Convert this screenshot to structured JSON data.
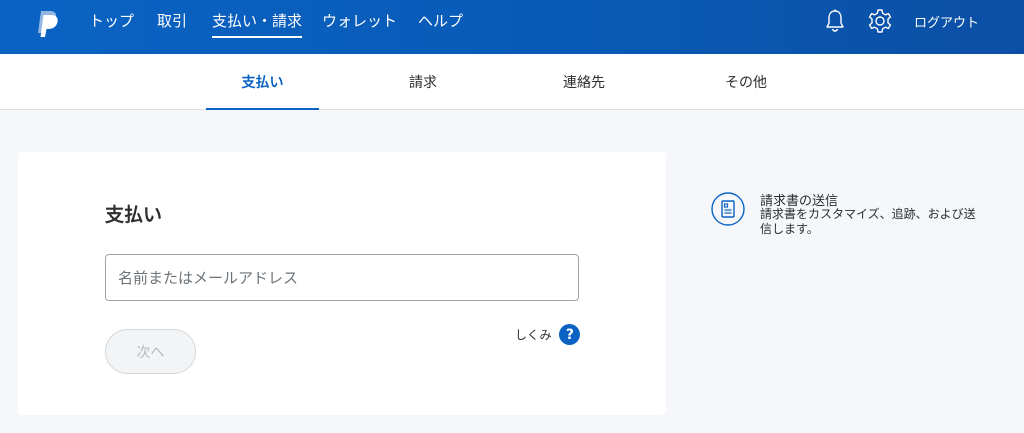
{
  "topnav": {
    "items": [
      {
        "label": "トップ"
      },
      {
        "label": "取引"
      },
      {
        "label": "支払い・請求"
      },
      {
        "label": "ウォレット"
      },
      {
        "label": "ヘルプ"
      }
    ],
    "active_index": 2,
    "logout_label": "ログアウト",
    "icons": [
      "paypal-logo-icon",
      "bell-icon",
      "gear-icon"
    ]
  },
  "tabs": {
    "items": [
      {
        "label": "支払い"
      },
      {
        "label": "請求"
      },
      {
        "label": "連絡先"
      },
      {
        "label": "その他"
      }
    ],
    "active_index": 0
  },
  "payment_card": {
    "title": "支払い",
    "input_placeholder": "名前またはメールアドレス",
    "input_value": "",
    "next_label": "次へ",
    "how_label": "しくみ",
    "help_symbol": "?"
  },
  "promo": {
    "title": "請求書の送信",
    "description": "請求書をカスタマイズ、追跡、および送信します。"
  },
  "colors": {
    "brand_blue": "#0a63c3",
    "text_dark": "#2c2e2f",
    "page_bg": "#f5f7fa"
  }
}
